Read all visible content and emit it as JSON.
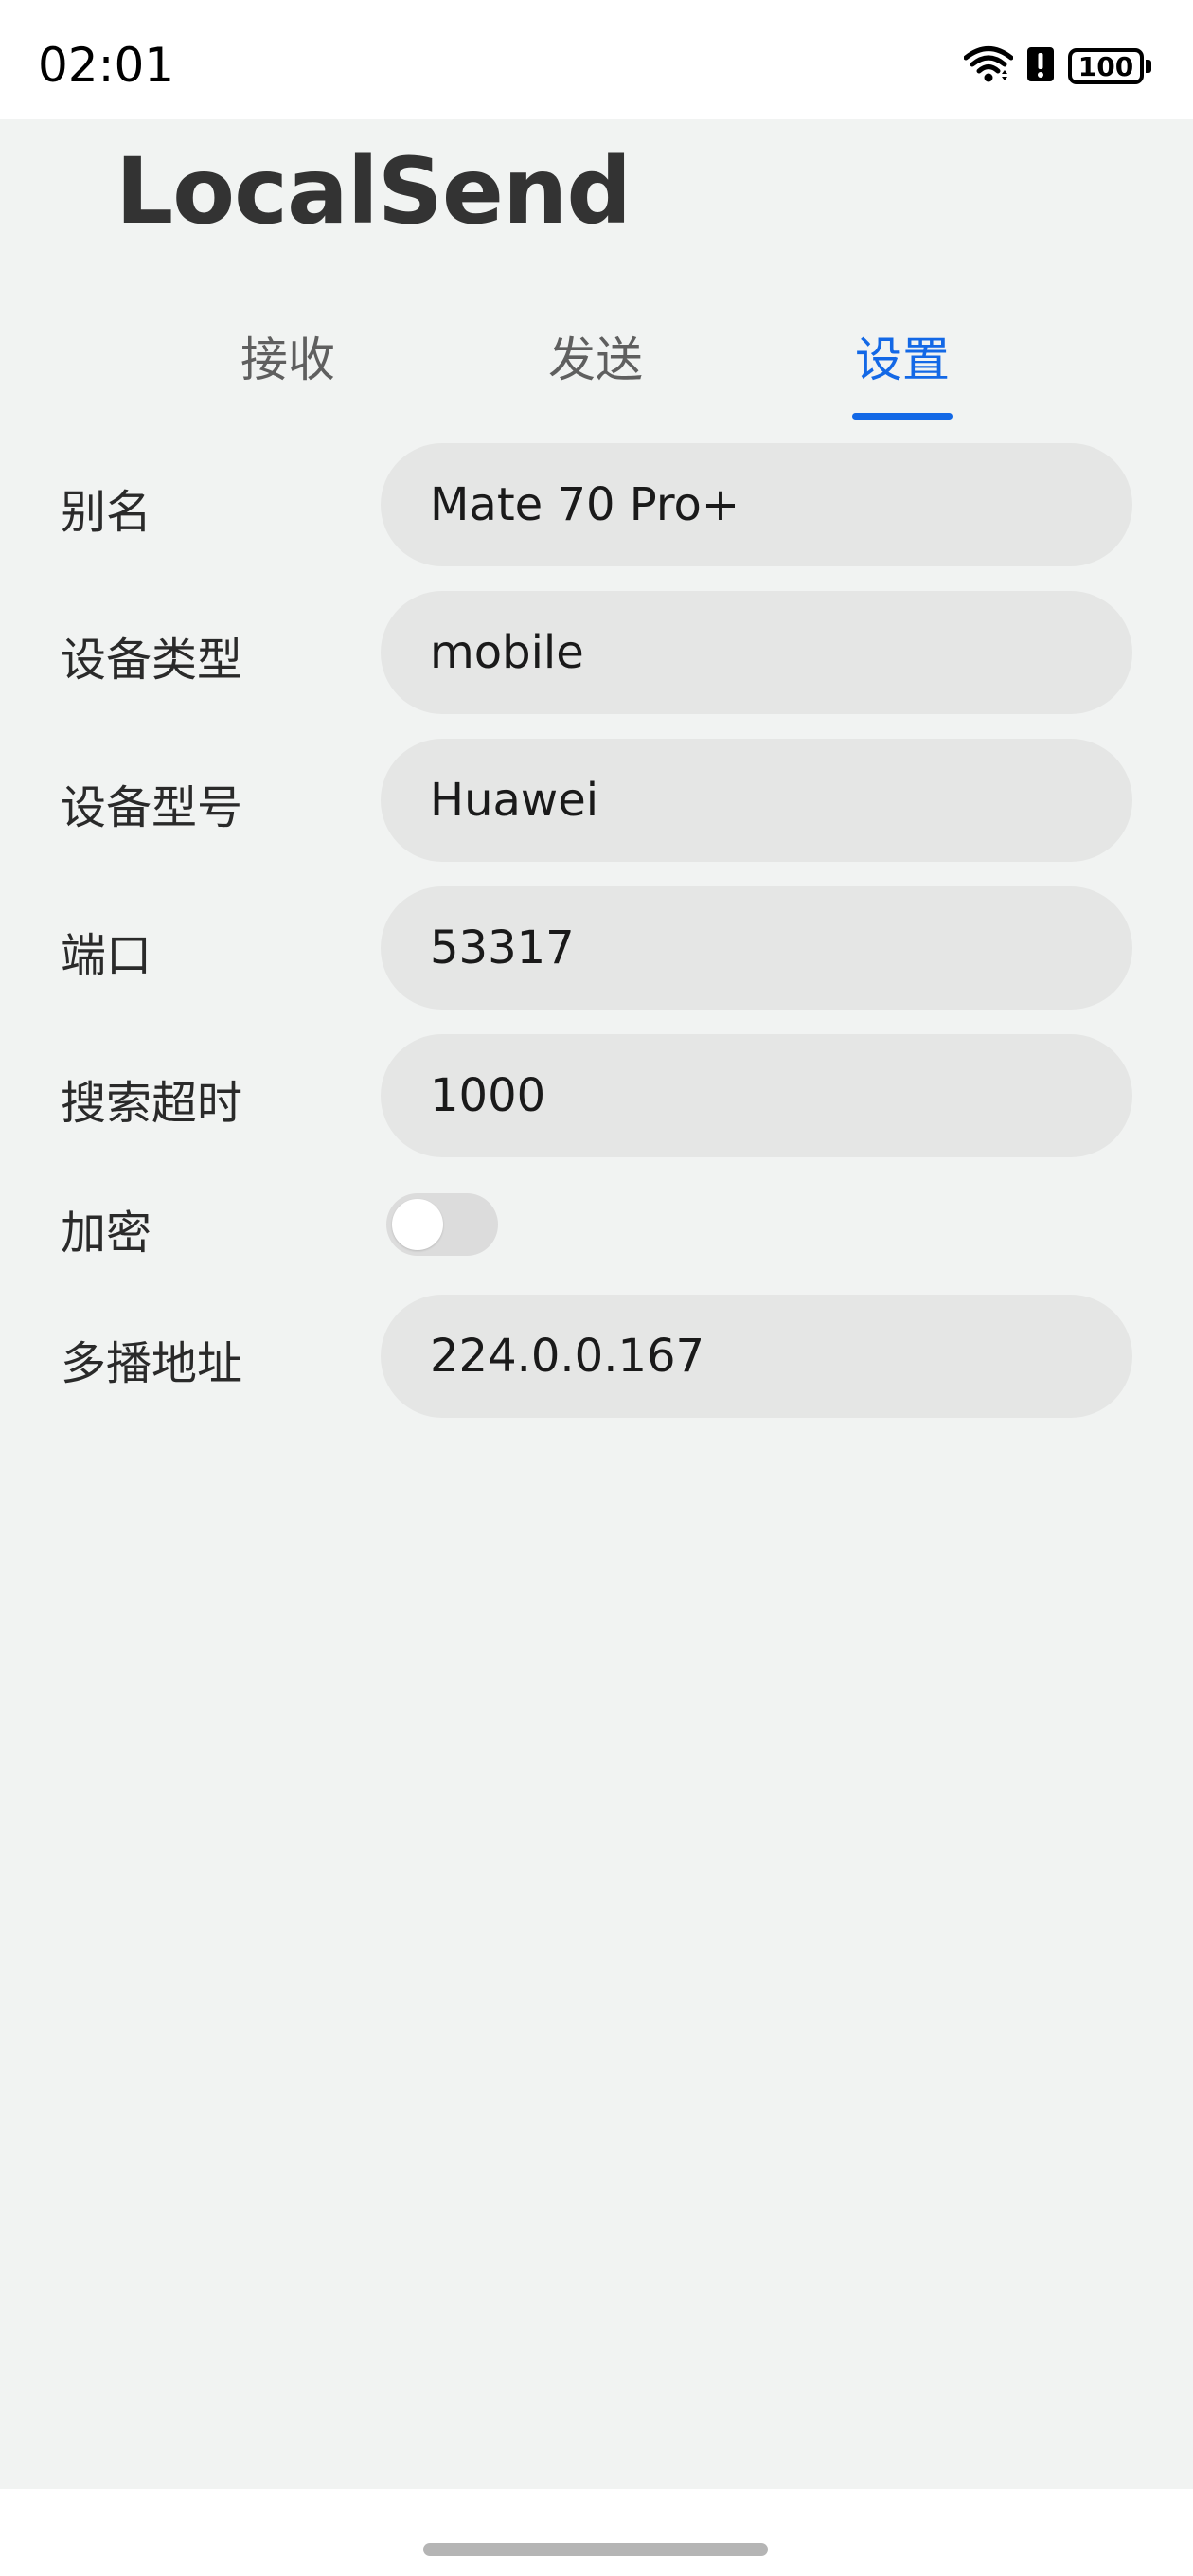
{
  "status_bar": {
    "time": "02:01",
    "battery": "100",
    "icons": [
      "wifi-icon",
      "alert-icon",
      "battery-icon"
    ]
  },
  "app": {
    "title": "LocalSend"
  },
  "tabs": [
    {
      "label": "接收",
      "active": false
    },
    {
      "label": "发送",
      "active": false
    },
    {
      "label": "设置",
      "active": true
    }
  ],
  "settings": {
    "alias": {
      "label": "别名",
      "value": "Mate 70 Pro+"
    },
    "device_type": {
      "label": "设备类型",
      "value": "mobile"
    },
    "device_model": {
      "label": "设备型号",
      "value": "Huawei"
    },
    "port": {
      "label": "端口",
      "value": "53317"
    },
    "discovery_timeout": {
      "label": "搜索超时",
      "value": "1000"
    },
    "encryption": {
      "label": "加密",
      "enabled": false
    },
    "multicast_address": {
      "label": "多播地址",
      "value": "224.0.0.167"
    }
  },
  "colors": {
    "accent": "#1368e6",
    "background": "#f1f3f2",
    "field": "#e5e6e5"
  }
}
